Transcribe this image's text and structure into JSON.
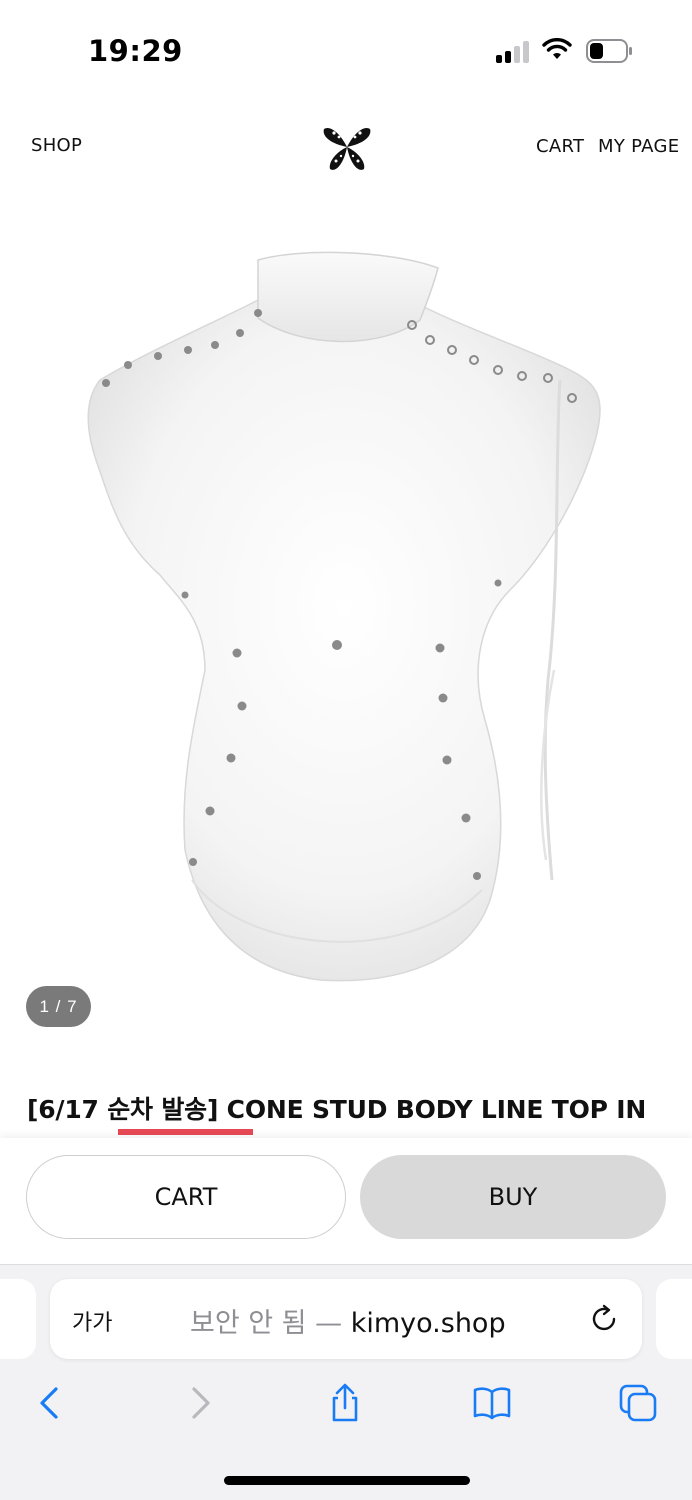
{
  "status_bar": {
    "time": "19:29"
  },
  "header": {
    "shop_label": "SHOP",
    "cart_label": "CART",
    "mypage_label": "MY PAGE",
    "logo_icon": "butterfly-logo"
  },
  "product": {
    "image_subject": "white turtleneck sleeveless top with cone studs and lace-up shoulder",
    "pager": "1 / 7",
    "title": "[6/17 순차 발송] CONE STUD BODY LINE TOP IN"
  },
  "purchase_bar": {
    "cart_label": "CART",
    "buy_label": "BUY"
  },
  "browser": {
    "aa_label": "가가",
    "url_insecure": "보안 안 됨 —",
    "url_domain": "kimyo.shop",
    "accent_color": "#1a7cf5"
  }
}
